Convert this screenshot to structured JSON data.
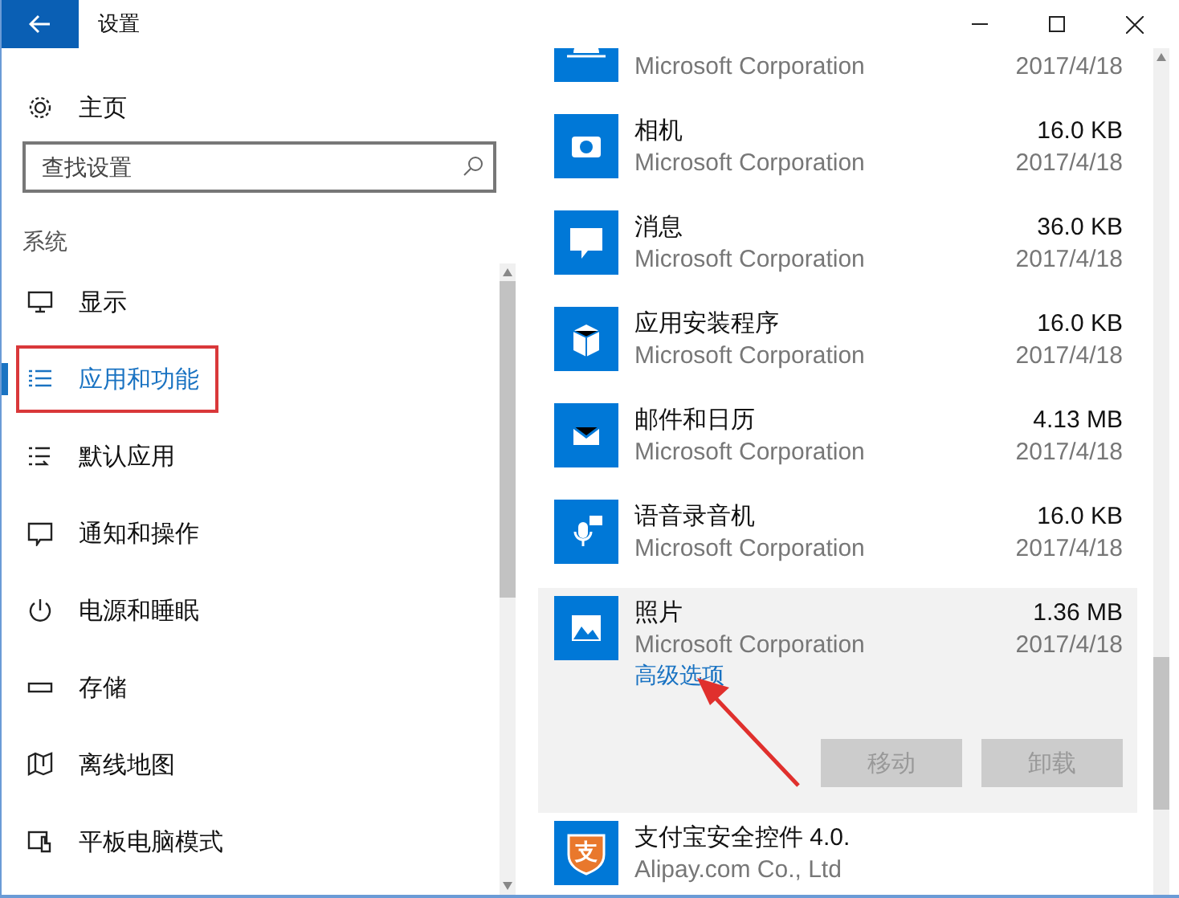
{
  "window": {
    "title": "设置"
  },
  "sidebar": {
    "home": "主页",
    "search": {
      "placeholder": "查找设置"
    },
    "section": "系统",
    "items": [
      {
        "label": "显示",
        "selected": false,
        "highlighted": false
      },
      {
        "label": "应用和功能",
        "selected": true,
        "highlighted": true
      },
      {
        "label": "默认应用",
        "selected": false,
        "highlighted": false
      },
      {
        "label": "通知和操作",
        "selected": false,
        "highlighted": false
      },
      {
        "label": "电源和睡眠",
        "selected": false,
        "highlighted": false
      },
      {
        "label": "存储",
        "selected": false,
        "highlighted": false
      },
      {
        "label": "离线地图",
        "selected": false,
        "highlighted": false
      },
      {
        "label": "平板电脑模式",
        "selected": false,
        "highlighted": false
      }
    ]
  },
  "apps": [
    {
      "publisher": "Microsoft Corporation",
      "date": "2017/4/18",
      "expanded": false,
      "arrow": false
    },
    {
      "name": "相机",
      "size": "16.0 KB",
      "publisher": "Microsoft Corporation",
      "date": "2017/4/18",
      "expanded": false,
      "arrow": false
    },
    {
      "name": "消息",
      "size": "36.0 KB",
      "publisher": "Microsoft Corporation",
      "date": "2017/4/18",
      "expanded": false,
      "arrow": false
    },
    {
      "name": "应用安装程序",
      "size": "16.0 KB",
      "publisher": "Microsoft Corporation",
      "date": "2017/4/18",
      "expanded": false,
      "arrow": false
    },
    {
      "name": "邮件和日历",
      "size": "4.13 MB",
      "publisher": "Microsoft Corporation",
      "date": "2017/4/18",
      "expanded": false,
      "arrow": false
    },
    {
      "name": "语音录音机",
      "size": "16.0 KB",
      "publisher": "Microsoft Corporation",
      "date": "2017/4/18",
      "expanded": false,
      "arrow": false
    },
    {
      "name": "照片",
      "size": "1.36 MB",
      "publisher": "Microsoft Corporation",
      "date": "2017/4/18",
      "expanded": true,
      "arrow": true,
      "link": "高级选项",
      "buttons": [
        {
          "label": "移动",
          "disabled": true
        },
        {
          "label": "卸载",
          "disabled": true
        }
      ]
    },
    {
      "icon_glyph": "支",
      "name": "支付宝安全控件 4.0.",
      "publisher": "Alipay.com Co., Ltd",
      "expanded": false,
      "arrow": false
    }
  ]
}
